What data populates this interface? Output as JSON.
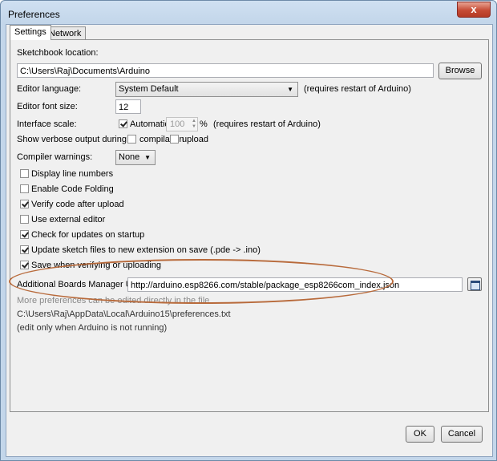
{
  "window": {
    "title": "Preferences",
    "close_glyph": "x"
  },
  "tabs": [
    {
      "label": "Settings",
      "active": true
    },
    {
      "label": "Network",
      "active": false
    }
  ],
  "sketchbook": {
    "label": "Sketchbook location:",
    "value": "C:\\Users\\Raj\\Documents\\Arduino",
    "browse_label": "Browse"
  },
  "language": {
    "label": "Editor language:",
    "value": "System Default",
    "note": "(requires restart of Arduino)"
  },
  "font_size": {
    "label": "Editor font size:",
    "value": "12"
  },
  "interface_scale": {
    "label": "Interface scale:",
    "automatic_label": "Automatic",
    "automatic_checked": true,
    "value": "100",
    "unit": "%",
    "note": "(requires restart of Arduino)"
  },
  "verbose": {
    "label": "Show verbose output during:",
    "compilation_label": "compilation",
    "compilation_checked": false,
    "upload_label": "upload",
    "upload_checked": false
  },
  "compiler_warnings": {
    "label": "Compiler warnings:",
    "value": "None"
  },
  "options": [
    {
      "label": "Display line numbers",
      "checked": false
    },
    {
      "label": "Enable Code Folding",
      "checked": false
    },
    {
      "label": "Verify code after upload",
      "checked": true
    },
    {
      "label": "Use external editor",
      "checked": false
    },
    {
      "label": "Check for updates on startup",
      "checked": true
    },
    {
      "label": "Update sketch files to new extension on save (.pde -> .ino)",
      "checked": true
    },
    {
      "label": "Save when verifying or uploading",
      "checked": true
    }
  ],
  "boards_manager": {
    "label": "Additional Boards Manager URLs:",
    "value": "http://arduino.esp8266.com/stable/package_esp8266com_index.json"
  },
  "info": {
    "more_prefs": "More preferences can be edited directly in the file",
    "path": "C:\\Users\\Raj\\AppData\\Local\\Arduino15\\preferences.txt",
    "note": "(edit only when Arduino is not running)"
  },
  "buttons": {
    "ok": "OK",
    "cancel": "Cancel"
  },
  "colors": {
    "annotation_ellipse": "#b86a3b",
    "title_bar": "#c3d6ea",
    "close_button": "#c64b35"
  }
}
